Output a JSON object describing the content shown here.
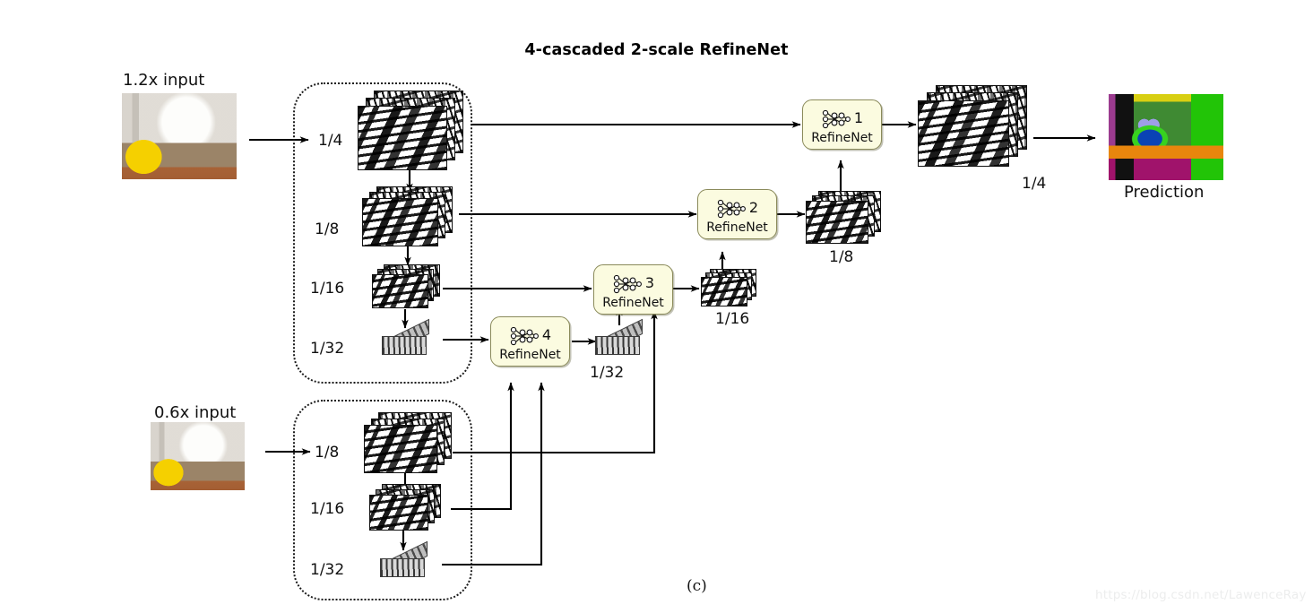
{
  "figure": {
    "title": "4-cascaded 2-scale RefineNet",
    "subfigure_label": "(c)",
    "watermark": "https://blog.csdn.net/LawenceRay"
  },
  "inputs": [
    {
      "id": "input-12x",
      "label": "1.2x input",
      "image": "indoor-living-room-photo"
    },
    {
      "id": "input-06x",
      "label": "0.6x input",
      "image": "indoor-living-room-photo"
    }
  ],
  "output": {
    "label": "Prediction",
    "image": "semantic-segmentation-map"
  },
  "encoder_paths": [
    {
      "id": "encoder-top",
      "source_input": "1.2x input",
      "scales": [
        {
          "label": "1/4",
          "type": "feature-map-stack"
        },
        {
          "label": "1/8",
          "type": "feature-map-stack"
        },
        {
          "label": "1/16",
          "type": "feature-map-stack"
        },
        {
          "label": "1/32",
          "type": "feature-slab"
        }
      ]
    },
    {
      "id": "encoder-bottom",
      "source_input": "0.6x input",
      "scales": [
        {
          "label": "1/8",
          "type": "feature-map-stack"
        },
        {
          "label": "1/16",
          "type": "feature-map-stack"
        },
        {
          "label": "1/32",
          "type": "feature-slab"
        }
      ]
    }
  ],
  "refinenet_blocks": [
    {
      "id": "refinenet-1",
      "number": "1",
      "name": "RefineNet",
      "icon": "neural-network-icon"
    },
    {
      "id": "refinenet-2",
      "number": "2",
      "name": "RefineNet",
      "icon": "neural-network-icon"
    },
    {
      "id": "refinenet-3",
      "number": "3",
      "name": "RefineNet",
      "icon": "neural-network-icon"
    },
    {
      "id": "refinenet-4",
      "number": "4",
      "name": "RefineNet",
      "icon": "neural-network-icon"
    }
  ],
  "refinenet_outputs": [
    {
      "id": "out-1",
      "label": "1/4",
      "from": "refinenet-1",
      "type": "feature-map-stack"
    },
    {
      "id": "out-2",
      "label": "1/8",
      "from": "refinenet-2",
      "type": "feature-map-stack"
    },
    {
      "id": "out-3",
      "label": "1/16",
      "from": "refinenet-3",
      "type": "feature-map-stack"
    },
    {
      "id": "out-4",
      "label": "1/32",
      "from": "refinenet-4",
      "type": "feature-slab"
    }
  ],
  "colors": {
    "refinenet_fill": "#fbfbe0",
    "refinenet_border": "#8a8a5a",
    "box_border": "#1a1a1a",
    "arrow": "#000000",
    "text": "#111111",
    "watermark": "#eceded"
  }
}
